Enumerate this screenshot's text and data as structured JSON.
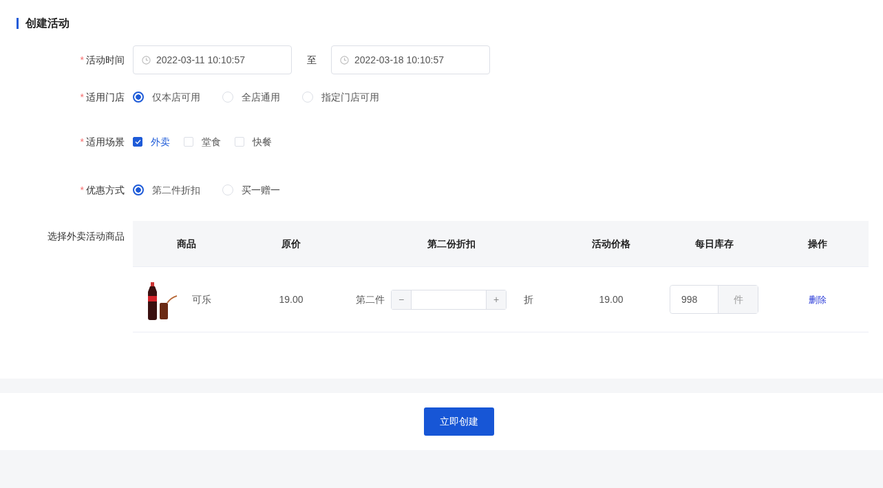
{
  "title": "创建活动",
  "form": {
    "time": {
      "label": "活动时间",
      "required_mark": "*",
      "start": "2022-03-11 10:10:57",
      "separator": "至",
      "end": "2022-03-18 10:10:57"
    },
    "stores": {
      "label": "适用门店",
      "required_mark": "*",
      "options": [
        {
          "label": "仅本店可用",
          "selected": true
        },
        {
          "label": "全店通用",
          "selected": false
        },
        {
          "label": "指定门店可用",
          "selected": false
        }
      ]
    },
    "scenes": {
      "label": "适用场景",
      "required_mark": "*",
      "options": [
        {
          "label": "外卖",
          "checked": true
        },
        {
          "label": "堂食",
          "checked": false
        },
        {
          "label": "快餐",
          "checked": false
        }
      ]
    },
    "discount_type": {
      "label": "优惠方式",
      "required_mark": "*",
      "options": [
        {
          "label": "第二件折扣",
          "selected": true
        },
        {
          "label": "买一赠一",
          "selected": false
        }
      ]
    },
    "products": {
      "label": "选择外卖活动商品",
      "columns": [
        "商品",
        "原价",
        "第二份折扣",
        "活动价格",
        "每日库存",
        "操作"
      ],
      "rows": [
        {
          "name": "可乐",
          "price": "19.00",
          "discount_prefix": "第二件",
          "minus": "−",
          "plus": "+",
          "discount_suffix": "折",
          "activity_price": "19.00",
          "stock": "998",
          "stock_unit": "件",
          "action": "删除"
        }
      ]
    }
  },
  "submit": "立即创建"
}
